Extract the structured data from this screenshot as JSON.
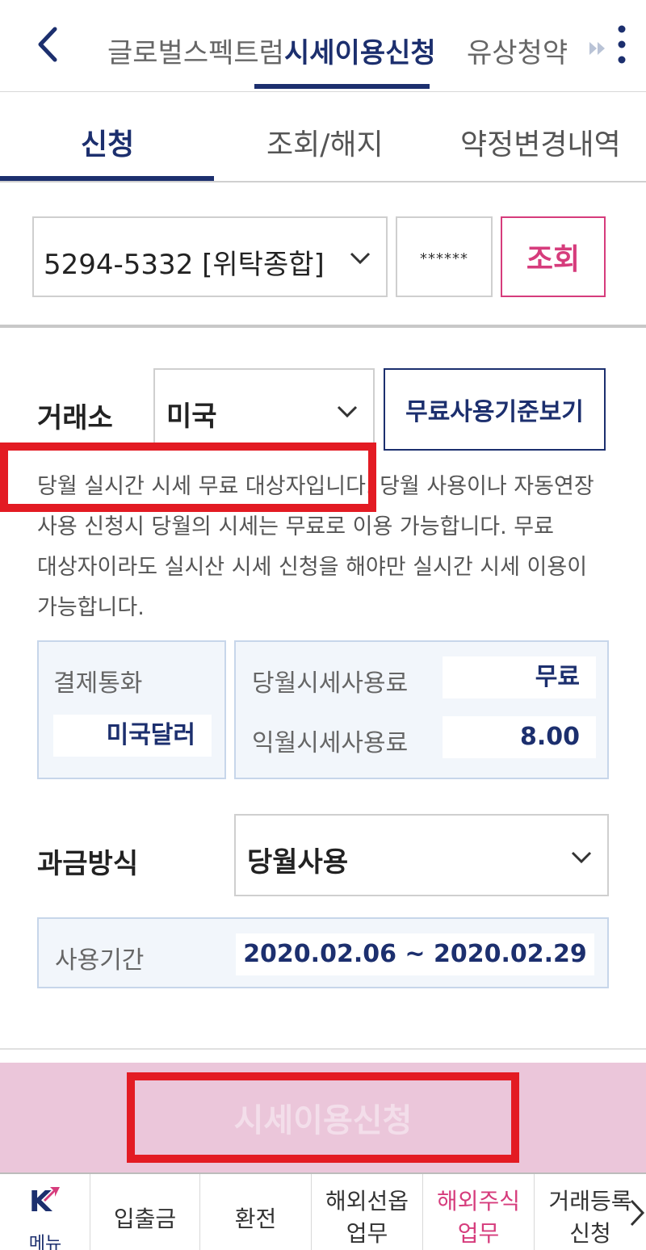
{
  "top_tabs": [
    "글로벌스펙트럼",
    "시세이용신청",
    "유상청약"
  ],
  "sub_tabs": [
    "신청",
    "조회/해지",
    "약정변경내역"
  ],
  "account": {
    "number": "5294-5332 [위탁종합]",
    "password_mask": "******",
    "query_label": "조회"
  },
  "exchange": {
    "label": "거래소",
    "value": "미국",
    "free_criteria_label": "무료사용기준보기"
  },
  "notice": {
    "line1": "당월 실시간 시세 무료 대상자입니다. 당월 사용이나 자동연장",
    "line2": "사용 신청시 당월의 시세는 무료로 이용 가능합니다. 무료",
    "line3": "대상자이라도 실시산 시세 신청을 해야만 실시간 시세 이용이",
    "line4": "가능합니다."
  },
  "payment": {
    "currency_label": "결제통화",
    "currency_value": "미국달러",
    "this_month_label": "당월시세사용료",
    "this_month_value": "무료",
    "next_month_label": "익월시세사용료",
    "next_month_value": "8.00"
  },
  "billing": {
    "label": "과금방식",
    "value": "당월사용"
  },
  "period": {
    "label": "사용기간",
    "value": "2020.02.06 ~ 2020.02.29"
  },
  "apply_button": "시세이용신청",
  "bottom_nav": {
    "menu_label": "메뉴",
    "menu_logo": "K",
    "items": [
      {
        "line1": "입출금",
        "line2": ""
      },
      {
        "line1": "환전",
        "line2": ""
      },
      {
        "line1": "해외선옵",
        "line2": "업무"
      },
      {
        "line1": "해외주식",
        "line2": "업무"
      },
      {
        "line1": "거래등록",
        "line2": "신청"
      }
    ]
  },
  "colors": {
    "navy": "#1c2f6e",
    "pink": "#d63c7c",
    "highlight_red": "#e31b23",
    "apply_bg": "#ebc6da"
  }
}
